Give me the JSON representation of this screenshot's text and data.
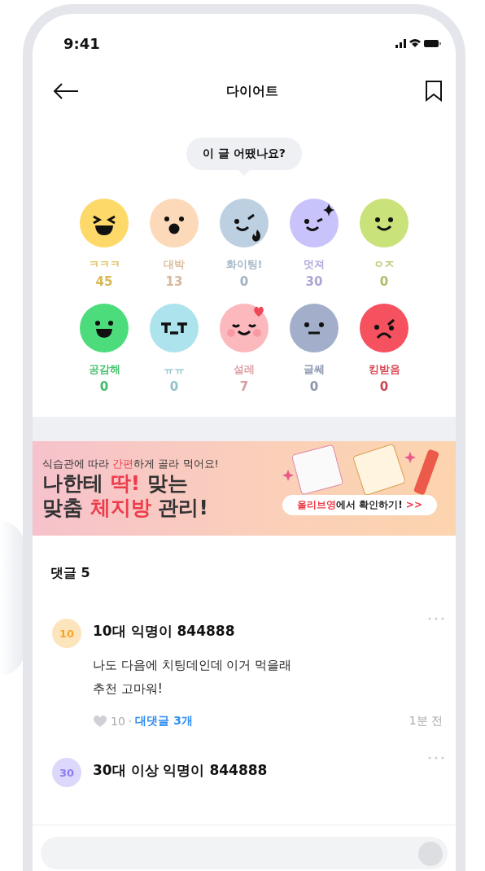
{
  "status_bar": {
    "time": "9:41"
  },
  "nav": {
    "title": "다이어트"
  },
  "prompt": "이 글 어땠나요?",
  "reactions": [
    {
      "kind": "laugh",
      "label": "ㅋㅋㅋ",
      "count": "45",
      "color": "#fcd968"
    },
    {
      "kind": "wow",
      "label": "대박",
      "count": "13",
      "color": "#fcd9b8"
    },
    {
      "kind": "fire",
      "label": "화이팅!",
      "count": "0",
      "color": "#bcd0e2"
    },
    {
      "kind": "sparkle",
      "label": "멋져",
      "count": "30",
      "color": "#c9c3fb"
    },
    {
      "kind": "smile",
      "label": "ㅇㅈ",
      "count": "0",
      "color": "#c9e27a"
    },
    {
      "kind": "grin",
      "label": "공감해",
      "count": "0",
      "color": "#4ddc7c"
    },
    {
      "kind": "cry",
      "label": "ㅠㅠ",
      "count": "0",
      "color": "#ade3ed"
    },
    {
      "kind": "love",
      "label": "설레",
      "count": "7",
      "color": "#fbb9bd"
    },
    {
      "kind": "meh",
      "label": "글쎄",
      "count": "0",
      "color": "#a3afca"
    },
    {
      "kind": "angry",
      "label": "킹받음",
      "count": "0",
      "color": "#f6515f"
    }
  ],
  "banner": {
    "subtitle": [
      {
        "text": "식습관에 따라 ",
        "highlight": false
      },
      {
        "text": "간편",
        "highlight": true
      },
      {
        "text": "하게 골라 먹어요!",
        "highlight": false
      }
    ],
    "headline_1": [
      {
        "text": "나한테 ",
        "highlight": false
      },
      {
        "text": "딱!",
        "highlight": true
      },
      {
        "text": " 맞는",
        "highlight": false
      }
    ],
    "headline_2": [
      {
        "text": "맞춤 ",
        "highlight": false
      },
      {
        "text": "체지방",
        "highlight": true
      },
      {
        "text": " 관리!",
        "highlight": false
      }
    ],
    "button": [
      {
        "text": "올리브영",
        "highlight": true
      },
      {
        "text": "에서 확인하기! ",
        "highlight": false
      },
      {
        "text": ">>",
        "highlight": true
      }
    ]
  },
  "comments_header": "댓글 5",
  "comments": [
    {
      "badge": "10",
      "color": "#f5a623",
      "author": "10대 익명이 844888",
      "body_lines": [
        "나도 다음에 치팅데인데 이거 먹을래",
        "추천 고마워!"
      ],
      "likes": "10",
      "separator": "·",
      "replies": "대댓글 3개",
      "time": "1분 전"
    },
    {
      "badge": "30",
      "color": "#8b7cf0",
      "author": "30대 이상 익명이 844888"
    }
  ]
}
